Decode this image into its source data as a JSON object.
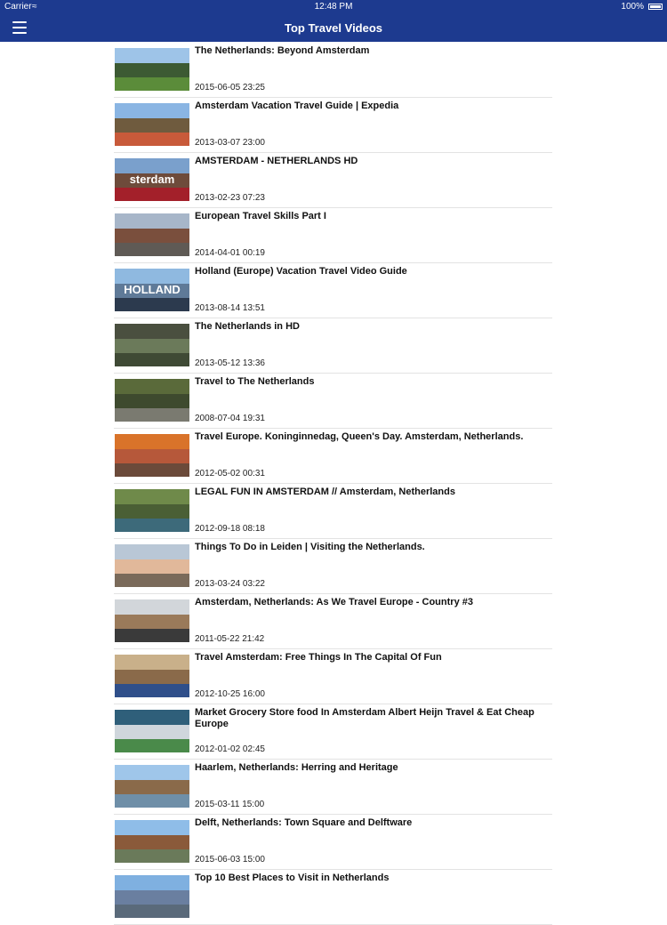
{
  "status": {
    "carrier": "Carrier",
    "time": "12:48 PM",
    "battery": "100%"
  },
  "nav": {
    "title": "Top Travel Videos"
  },
  "videos": [
    {
      "title": "The Netherlands: Beyond Amsterdam",
      "date": "2015-06-05 23:25",
      "sky": "#9ec4e8",
      "mid": "#3c5a33",
      "ground": "#5b8c3a",
      "overlay": ""
    },
    {
      "title": "Amsterdam Vacation Travel Guide | Expedia",
      "date": "2013-03-07 23:00",
      "sky": "#8ab5e3",
      "mid": "#6f5b3e",
      "ground": "#c85a3a",
      "overlay": ""
    },
    {
      "title": "AMSTERDAM - NETHERLANDS  HD",
      "date": "2013-02-23 07:23",
      "sky": "#7aa0cc",
      "mid": "#6e4b3b",
      "ground": "#a3202a",
      "overlay": "sterdam"
    },
    {
      "title": "European Travel Skills Part I",
      "date": "2014-04-01 00:19",
      "sky": "#a7b6c9",
      "mid": "#7a4f3d",
      "ground": "#5f5a55",
      "overlay": ""
    },
    {
      "title": "Holland (Europe) Vacation Travel Video Guide",
      "date": "2013-08-14 13:51",
      "sky": "#8fb9e0",
      "mid": "#5f7a98",
      "ground": "#2c3a4e",
      "overlay": "HOLLAND"
    },
    {
      "title": "The Netherlands in HD",
      "date": "2013-05-12 13:36",
      "sky": "#4a4f3f",
      "mid": "#6b7a5a",
      "ground": "#3f4a35",
      "overlay": ""
    },
    {
      "title": "Travel to The Netherlands",
      "date": "2008-07-04 19:31",
      "sky": "#5a6a3a",
      "mid": "#3e4a2e",
      "ground": "#7a7a70",
      "overlay": ""
    },
    {
      "title": "Travel Europe. Koninginnedag, Queen's Day. Amsterdam, Netherlands.",
      "date": "2012-05-02 00:31",
      "sky": "#d9732a",
      "mid": "#b6583a",
      "ground": "#6b4a3a",
      "overlay": ""
    },
    {
      "title": "LEGAL FUN IN AMSTERDAM // Amsterdam, Netherlands",
      "date": "2012-09-18 08:18",
      "sky": "#6f8a4a",
      "mid": "#4a5f35",
      "ground": "#3d6a7a",
      "overlay": ""
    },
    {
      "title": "Things To Do in Leiden | Visiting the Netherlands.",
      "date": "2013-03-24 03:22",
      "sky": "#b9c7d6",
      "mid": "#e1b89a",
      "ground": "#7a6a5a",
      "overlay": ""
    },
    {
      "title": "Amsterdam, Netherlands: As We Travel Europe - Country #3",
      "date": "2011-05-22 21:42",
      "sky": "#d2d6da",
      "mid": "#9a7a5a",
      "ground": "#3a3a3a",
      "overlay": ""
    },
    {
      "title": "Travel Amsterdam: Free Things In The Capital Of Fun",
      "date": "2012-10-25 16:00",
      "sky": "#c9b08a",
      "mid": "#8a6a4a",
      "ground": "#2f4f8a",
      "overlay": ""
    },
    {
      "title": "Market Grocery Store food In Amsterdam Albert Heijn Travel & Eat Cheap Europe",
      "date": "2012-01-02 02:45",
      "sky": "#2f5f7a",
      "mid": "#cfd6dc",
      "ground": "#4a8a4a",
      "overlay": ""
    },
    {
      "title": "Haarlem, Netherlands: Herring and Heritage",
      "date": "2015-03-11 15:00",
      "sky": "#9fc6ea",
      "mid": "#8a6a4a",
      "ground": "#6f8fa8",
      "overlay": ""
    },
    {
      "title": "Delft, Netherlands: Town Square and Delftware",
      "date": "2015-06-03 15:00",
      "sky": "#8fbde8",
      "mid": "#8a5a3a",
      "ground": "#6a7a5a",
      "overlay": ""
    },
    {
      "title": "Top 10 Best Places to Visit in Netherlands",
      "date": "",
      "sky": "#7fb0e0",
      "mid": "#6a7fa0",
      "ground": "#5a6a7a",
      "overlay": ""
    }
  ]
}
